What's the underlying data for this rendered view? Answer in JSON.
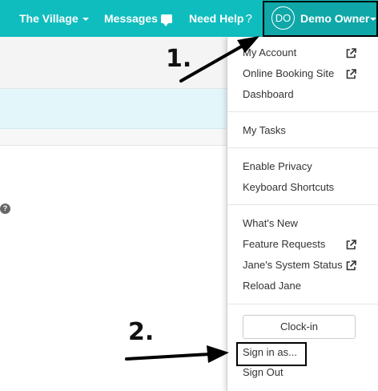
{
  "colors": {
    "nav_bg": "#10bdbe",
    "info_band": "#e3f7fb",
    "annotation": "#000000"
  },
  "nav": {
    "items": [
      {
        "label": "The Village",
        "has_caret": true
      },
      {
        "label": "Messages",
        "icon": "chat-bubble-icon"
      },
      {
        "label": "Need Help",
        "icon": "question-icon"
      }
    ],
    "help_icon_glyph": "?",
    "user": {
      "initials": "DO",
      "name": "Demo Owner"
    }
  },
  "page": {
    "help_glyph": "?"
  },
  "menu": {
    "sections": [
      {
        "items": [
          {
            "label": "My Account",
            "external": true
          },
          {
            "label": "Online Booking Site",
            "external": true
          },
          {
            "label": "Dashboard",
            "external": false
          }
        ]
      },
      {
        "items": [
          {
            "label": "My Tasks",
            "external": false
          }
        ]
      },
      {
        "items": [
          {
            "label": "Enable Privacy",
            "external": false
          },
          {
            "label": "Keyboard Shortcuts",
            "external": false
          }
        ]
      },
      {
        "items": [
          {
            "label": "What's New",
            "external": false
          },
          {
            "label": "Feature Requests",
            "external": true
          },
          {
            "label": "Jane's System Status",
            "external": true
          },
          {
            "label": "Reload Jane",
            "external": false
          }
        ]
      },
      {
        "items": [
          {
            "label": "Clock-in",
            "type": "button"
          },
          {
            "label": "Sign in as...",
            "highlighted": true
          },
          {
            "label": "Sign Out"
          }
        ]
      }
    ]
  },
  "annotations": {
    "step1": "1.",
    "step2": "2."
  }
}
